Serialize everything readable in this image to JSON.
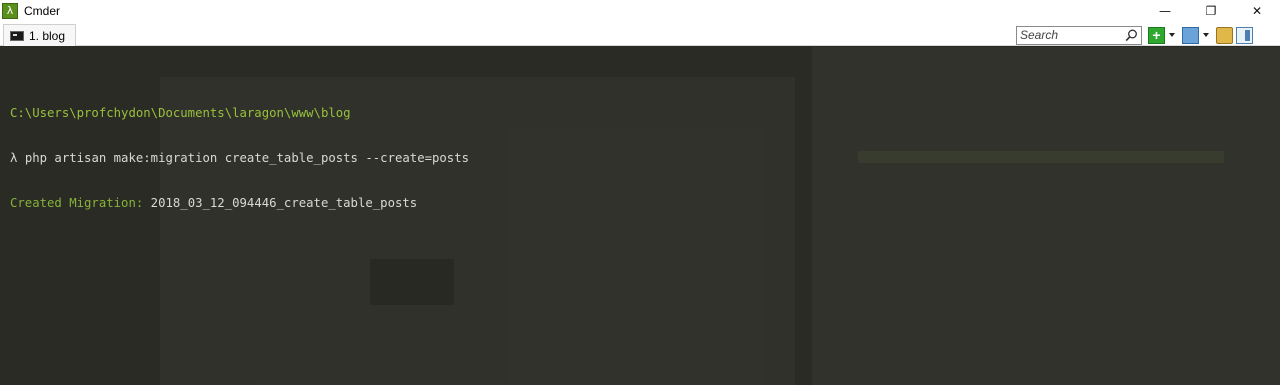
{
  "window": {
    "title": "Cmder",
    "app_icon_glyph": "λ",
    "controls": {
      "minimize": "—",
      "restore": "❐",
      "close": "✕"
    }
  },
  "tabs": [
    {
      "label": "1. blog",
      "icon": "console-icon"
    }
  ],
  "toolbar": {
    "search_placeholder": "Search",
    "buttons": [
      {
        "name": "new-console-button",
        "icon": "plus-icon"
      },
      {
        "name": "split-button",
        "icon": "split-icon"
      },
      {
        "name": "lock-button",
        "icon": "lock-icon"
      },
      {
        "name": "panel-button",
        "icon": "panel-icon"
      },
      {
        "name": "menu-button",
        "icon": "menu-icon"
      }
    ]
  },
  "console": {
    "path": "C:\\Users\\profchydon\\Documents\\laragon\\www\\blog",
    "prompt": "λ",
    "command": "php artisan make:migration create_table_posts --create=posts",
    "output_label": "Created Migration:",
    "output_value": "2018_03_12_094446_create_table_posts"
  },
  "colors": {
    "console_bg": "#2a2b24",
    "path_green": "#98c13c",
    "label_green": "#86b23a",
    "text": "#d9d9d2"
  }
}
